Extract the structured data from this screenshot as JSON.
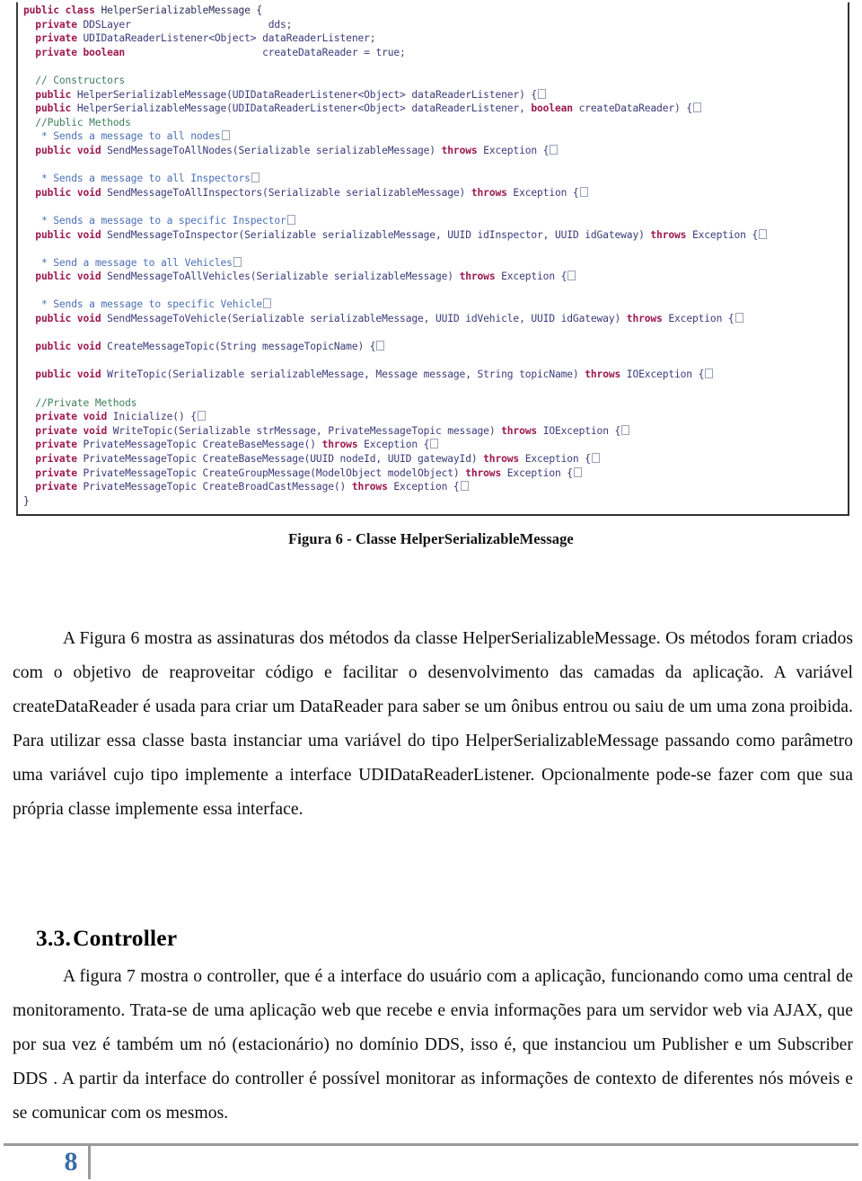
{
  "figure": {
    "caption": "Figura 6 - Classe HelperSerializableMessage",
    "code_lines": [
      [
        {
          "t": "public ",
          "c": "kw"
        },
        {
          "t": "class ",
          "c": "kw"
        },
        {
          "t": "HelperSerializableMessage {",
          "c": "pl"
        }
      ],
      [
        {
          "t": "  private ",
          "c": "kw"
        },
        {
          "t": "DDSLayer",
          "c": "id"
        },
        {
          "t": "                       ",
          "c": "pl"
        },
        {
          "t": "dds;",
          "c": "id"
        }
      ],
      [
        {
          "t": "  private ",
          "c": "kw"
        },
        {
          "t": "UDIDataReaderListener<Object> ",
          "c": "id"
        },
        {
          "t": "dataReaderListener;",
          "c": "id"
        }
      ],
      [
        {
          "t": "  private ",
          "c": "kw"
        },
        {
          "t": "boolean",
          "c": "kw"
        },
        {
          "t": "                       ",
          "c": "pl"
        },
        {
          "t": "createDataReader = ",
          "c": "id"
        },
        {
          "t": "true;",
          "c": "id"
        }
      ],
      [
        {
          "t": "",
          "c": "pl"
        }
      ],
      [
        {
          "t": "  // Constructors",
          "c": "cmt"
        }
      ],
      [
        {
          "t": "  public ",
          "c": "kw"
        },
        {
          "t": "HelperSerializableMessage(UDIDataReaderListener<Object> dataReaderListener) {",
          "c": "id"
        },
        {
          "t": "BOX",
          "c": "box"
        }
      ],
      [
        {
          "t": "  public ",
          "c": "kw"
        },
        {
          "t": "HelperSerializableMessage(UDIDataReaderListener<Object> dataReaderListener, ",
          "c": "id"
        },
        {
          "t": "boolean ",
          "c": "kw"
        },
        {
          "t": "createDataReader) {",
          "c": "id"
        },
        {
          "t": "BOX",
          "c": "box"
        }
      ],
      [
        {
          "t": "  //Public Methods",
          "c": "cmt"
        }
      ],
      [
        {
          "t": "   * Sends a message to all nodes",
          "c": "doc"
        },
        {
          "t": "BOX",
          "c": "box"
        }
      ],
      [
        {
          "t": "  public void ",
          "c": "kw"
        },
        {
          "t": "SendMessageToAllNodes(Serializable serializableMessage) ",
          "c": "id"
        },
        {
          "t": "throws ",
          "c": "kw"
        },
        {
          "t": "Exception {",
          "c": "id"
        },
        {
          "t": "BOX",
          "c": "box"
        }
      ],
      [
        {
          "t": "",
          "c": "pl"
        }
      ],
      [
        {
          "t": "   * Sends a message to all Inspectors",
          "c": "doc"
        },
        {
          "t": "BOX",
          "c": "box"
        }
      ],
      [
        {
          "t": "  public void ",
          "c": "kw"
        },
        {
          "t": "SendMessageToAllInspectors(Serializable serializableMessage) ",
          "c": "id"
        },
        {
          "t": "throws ",
          "c": "kw"
        },
        {
          "t": "Exception {",
          "c": "id"
        },
        {
          "t": "BOX",
          "c": "box"
        }
      ],
      [
        {
          "t": "",
          "c": "pl"
        }
      ],
      [
        {
          "t": "   * Sends a message to a specific Inspector",
          "c": "doc"
        },
        {
          "t": "BOX",
          "c": "box"
        }
      ],
      [
        {
          "t": "  public void ",
          "c": "kw"
        },
        {
          "t": "SendMessageToInspector(Serializable serializableMessage, UUID idInspector, UUID idGateway) ",
          "c": "id"
        },
        {
          "t": "throws ",
          "c": "kw"
        },
        {
          "t": "Exception {",
          "c": "id"
        },
        {
          "t": "BOX",
          "c": "box"
        }
      ],
      [
        {
          "t": "",
          "c": "pl"
        }
      ],
      [
        {
          "t": "   * Send a message to all Vehicles",
          "c": "doc"
        },
        {
          "t": "BOX",
          "c": "box"
        }
      ],
      [
        {
          "t": "  public void ",
          "c": "kw"
        },
        {
          "t": "SendMessageToAllVehicles(Serializable serializableMessage) ",
          "c": "id"
        },
        {
          "t": "throws ",
          "c": "kw"
        },
        {
          "t": "Exception {",
          "c": "id"
        },
        {
          "t": "BOX",
          "c": "box"
        }
      ],
      [
        {
          "t": "",
          "c": "pl"
        }
      ],
      [
        {
          "t": "   * Sends a message to specific Vehicle",
          "c": "doc"
        },
        {
          "t": "BOX",
          "c": "box"
        }
      ],
      [
        {
          "t": "  public void ",
          "c": "kw"
        },
        {
          "t": "SendMessageToVehicle(Serializable serializableMessage, UUID idVehicle, UUID idGateway) ",
          "c": "id"
        },
        {
          "t": "throws ",
          "c": "kw"
        },
        {
          "t": "Exception {",
          "c": "id"
        },
        {
          "t": "BOX",
          "c": "box"
        }
      ],
      [
        {
          "t": "",
          "c": "pl"
        }
      ],
      [
        {
          "t": "  public void ",
          "c": "kw"
        },
        {
          "t": "CreateMessageTopic(String messageTopicName) {",
          "c": "id"
        },
        {
          "t": "BOX",
          "c": "box"
        }
      ],
      [
        {
          "t": "",
          "c": "pl"
        }
      ],
      [
        {
          "t": "  public void ",
          "c": "kw"
        },
        {
          "t": "WriteTopic(Serializable serializableMessage, Message message, String topicName) ",
          "c": "id"
        },
        {
          "t": "throws ",
          "c": "kw"
        },
        {
          "t": "IOException {",
          "c": "id"
        },
        {
          "t": "BOX",
          "c": "box"
        }
      ],
      [
        {
          "t": "",
          "c": "pl"
        }
      ],
      [
        {
          "t": "  //Private Methods",
          "c": "cmt"
        }
      ],
      [
        {
          "t": "  private void ",
          "c": "kw"
        },
        {
          "t": "Inicialize() {",
          "c": "id"
        },
        {
          "t": "BOX",
          "c": "box"
        }
      ],
      [
        {
          "t": "  private void ",
          "c": "kw"
        },
        {
          "t": "WriteTopic(Serializable strMessage, PrivateMessageTopic message) ",
          "c": "id"
        },
        {
          "t": "throws ",
          "c": "kw"
        },
        {
          "t": "IOException {",
          "c": "id"
        },
        {
          "t": "BOX",
          "c": "box"
        }
      ],
      [
        {
          "t": "  private ",
          "c": "kw"
        },
        {
          "t": "PrivateMessageTopic CreateBaseMessage() ",
          "c": "id"
        },
        {
          "t": "throws ",
          "c": "kw"
        },
        {
          "t": "Exception {",
          "c": "id"
        },
        {
          "t": "BOX",
          "c": "box"
        }
      ],
      [
        {
          "t": "  private ",
          "c": "kw"
        },
        {
          "t": "PrivateMessageTopic CreateBaseMessage(UUID nodeId, UUID gatewayId) ",
          "c": "id"
        },
        {
          "t": "throws ",
          "c": "kw"
        },
        {
          "t": "Exception {",
          "c": "id"
        },
        {
          "t": "BOX",
          "c": "box"
        }
      ],
      [
        {
          "t": "  private ",
          "c": "kw"
        },
        {
          "t": "PrivateMessageTopic CreateGroupMessage(ModelObject modelObject) ",
          "c": "id"
        },
        {
          "t": "throws ",
          "c": "kw"
        },
        {
          "t": "Exception {",
          "c": "id"
        },
        {
          "t": "BOX",
          "c": "box"
        }
      ],
      [
        {
          "t": "  private ",
          "c": "kw"
        },
        {
          "t": "PrivateMessageTopic CreateBroadCastMessage() ",
          "c": "id"
        },
        {
          "t": "throws ",
          "c": "kw"
        },
        {
          "t": "Exception {",
          "c": "id"
        },
        {
          "t": "BOX",
          "c": "box"
        }
      ],
      [
        {
          "t": "}",
          "c": "pl"
        }
      ]
    ]
  },
  "body": {
    "paragraph_1": "A Figura 6 mostra as assinaturas dos métodos da classe HelperSerializableMessage. Os métodos foram criados com o objetivo de reaproveitar código e facilitar o desenvolvimento das camadas da aplicação. A variável createDataReader é usada para criar um DataReader para saber se um ônibus entrou ou saiu de um uma zona proibida. Para utilizar essa classe basta instanciar uma variável do tipo HelperSerializableMessage passando como parâmetro uma variável cujo tipo implemente a interface UDIDataReaderListener. Opcionalmente pode-se fazer com que sua própria classe implemente essa interface.",
    "paragraph_2": "A figura 7 mostra o controller, que é a interface do usuário com a aplicação, funcionando como uma central de monitoramento. Trata-se de uma aplicação web que recebe e envia informações para um servidor web via AJAX, que por sua vez é também um nó (estacionário) no domínio DDS, isso é, que instanciou um Publisher e um Subscriber  DDS . A partir da interface do controller é possível monitorar as informações de contexto de diferentes nós móveis e se comunicar com os mesmos."
  },
  "heading": {
    "number": "3.3.",
    "title": "Controller"
  },
  "footer": {
    "page_number": "8"
  },
  "colors": {
    "keyword": "#9c1a50",
    "comment": "#3f7f5f",
    "javadoc": "#4a6fb5",
    "identifier": "#3b3b7a",
    "page_number": "#3b6ea5",
    "footer_rule": "#9a9a9a"
  }
}
